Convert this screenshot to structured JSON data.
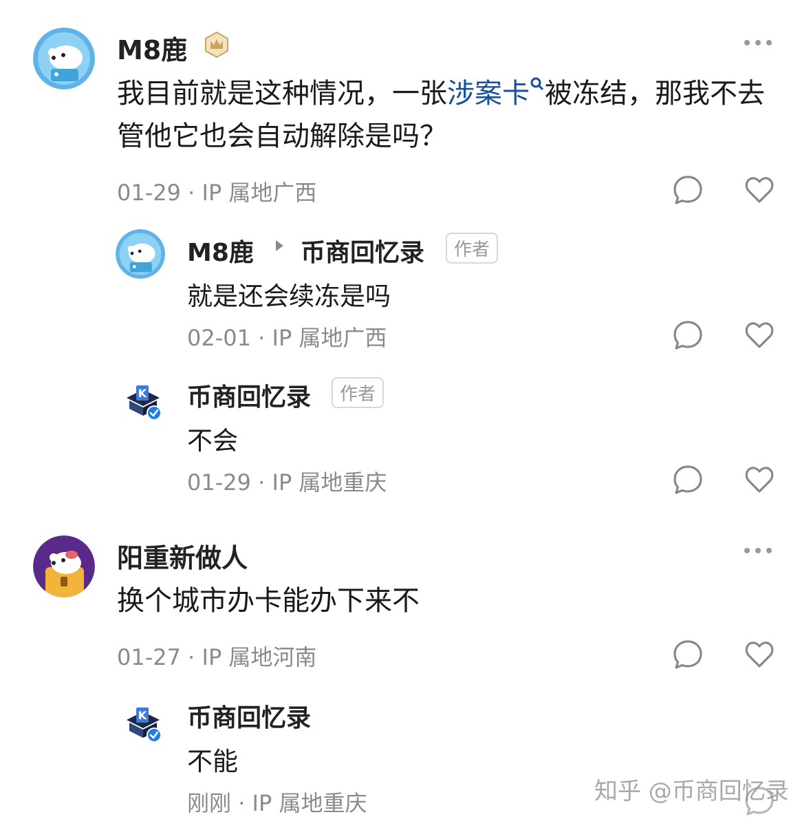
{
  "comments": [
    {
      "author": "M8鹿",
      "content_pre": "我目前就是这种情况，一张",
      "content_link": "涉案卡",
      "content_post": "被冻结，那我不去管他它也会自动解除是吗？",
      "date": "01-29",
      "ip": "IP 属地广西",
      "replies": [
        {
          "author": "M8鹿",
          "reply_to": "币商回忆录",
          "tag": "作者",
          "content": "就是还会续冻是吗",
          "date": "02-01",
          "ip": "IP 属地广西"
        },
        {
          "author": "币商回忆录",
          "tag": "作者",
          "content": "不会",
          "date": "01-29",
          "ip": "IP 属地重庆"
        }
      ]
    },
    {
      "author": "阳重新做人",
      "content": "换个城市办卡能办下来不",
      "date": "01-27",
      "ip": "IP 属地河南",
      "replies": [
        {
          "author": "币商回忆录",
          "content": "不能",
          "date": "刚刚",
          "ip": "IP 属地重庆"
        }
      ]
    }
  ],
  "separator": "·",
  "watermark": "知乎 @币商回忆录",
  "colors": {
    "link": "#175199",
    "meta": "#8a8a8a",
    "badge_gold": "#c9a45c",
    "verified": "#1f7ee8"
  },
  "icons": [
    "more-icon",
    "comment-icon",
    "like-icon",
    "crown-badge-icon",
    "verified-badge-icon",
    "search-icon"
  ]
}
